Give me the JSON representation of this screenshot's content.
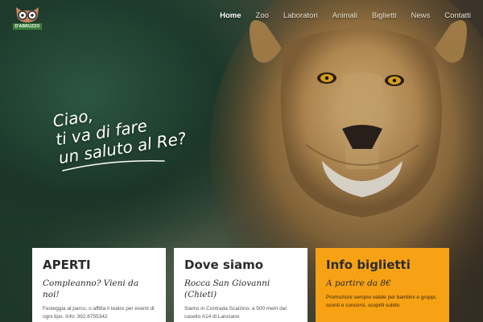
{
  "brand": {
    "name": "Zoo",
    "logo_text": "D'ABRUZZO"
  },
  "nav": {
    "items": [
      {
        "label": "Home",
        "active": true
      },
      {
        "label": "Zoo",
        "active": false
      },
      {
        "label": "Laboratori",
        "active": false
      },
      {
        "label": "Animali",
        "active": false
      },
      {
        "label": "Biglietti",
        "active": false
      },
      {
        "label": "News",
        "active": false
      },
      {
        "label": "Contatti",
        "active": false
      }
    ]
  },
  "hero": {
    "line1": "Ciao,",
    "line2": "ti va di fare",
    "line3": "un saluto al Re?"
  },
  "cards": [
    {
      "title": "APERTI",
      "subtitle": "Compleanno? Vieni da noi!",
      "text": "Festeggia al parco, o affitta il teatro per eventi di ogni tipo. Info: 392.6755342"
    },
    {
      "title": "Dove siamo",
      "subtitle": "Rocca San Giovanni (Chieti)",
      "text": "Siamo in Contrada Scalzino, a 500 metri dal casello A14 di Lanciano"
    },
    {
      "title": "Info biglietti",
      "subtitle": "A partire da 8€",
      "text": "Promozioni sempre valide per bambini e gruppi, sconti e concorsi, scoprili subito"
    }
  ],
  "colors": {
    "accent": "#f7a215",
    "brand_green": "#3a7d3c",
    "button_dark": "#3b2f23"
  }
}
